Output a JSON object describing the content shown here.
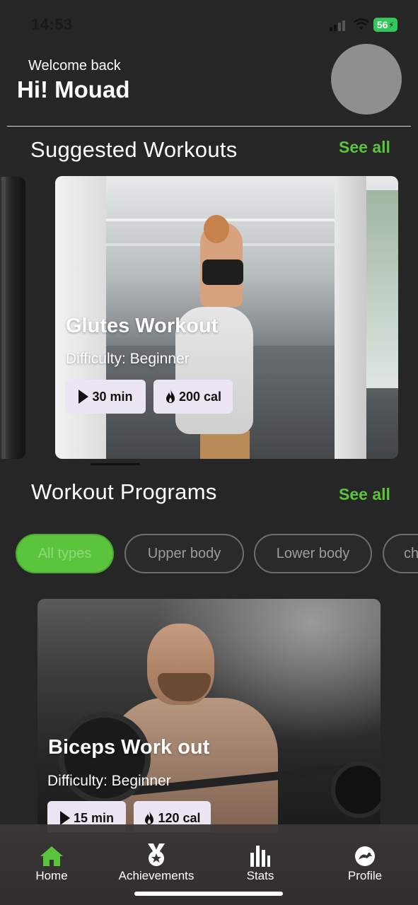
{
  "status_bar": {
    "time": "14:53",
    "battery": "56"
  },
  "header": {
    "welcome": "Welcome back",
    "greeting": "Hi! Mouad"
  },
  "suggested": {
    "title": "Suggested Workouts",
    "see_all": "See all",
    "card": {
      "title": "Glutes Workout",
      "difficulty": "Difficulty: Beginner",
      "duration": "30 min",
      "calories": "200 cal"
    }
  },
  "programs": {
    "title": "Workout Programs",
    "see_all": "See all",
    "filters": [
      "All types",
      "Upper body",
      "Lower body",
      "ch"
    ],
    "card": {
      "title": "Biceps Work out",
      "difficulty": "Difficulty: Beginner",
      "duration": "15 min",
      "calories": "120 cal"
    }
  },
  "tabbar": {
    "home": "Home",
    "achievements": "Achievements",
    "stats": "Stats",
    "profile": "Profile"
  },
  "colors": {
    "accent": "#5bc43d",
    "background": "#262626",
    "chip": "#ece6f4"
  }
}
